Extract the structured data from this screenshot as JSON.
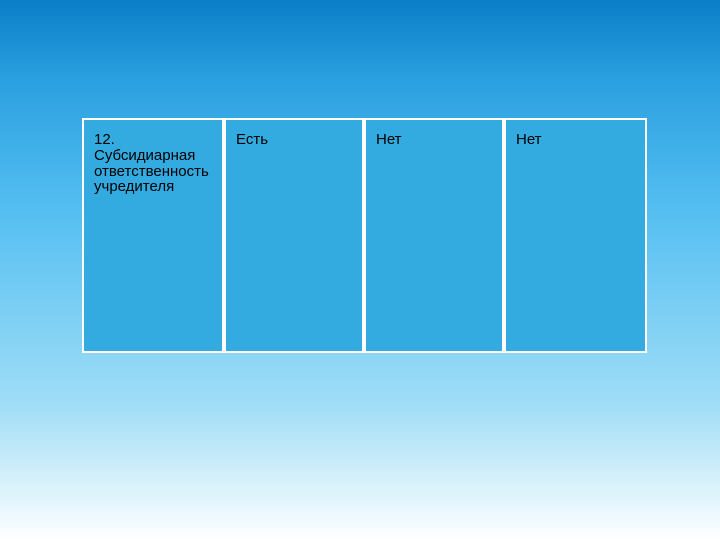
{
  "table": {
    "row": {
      "label": "12. Субсидиарная ответственность учредителя",
      "col1": "Есть",
      "col2": "Нет",
      "col3": "Нет"
    }
  }
}
